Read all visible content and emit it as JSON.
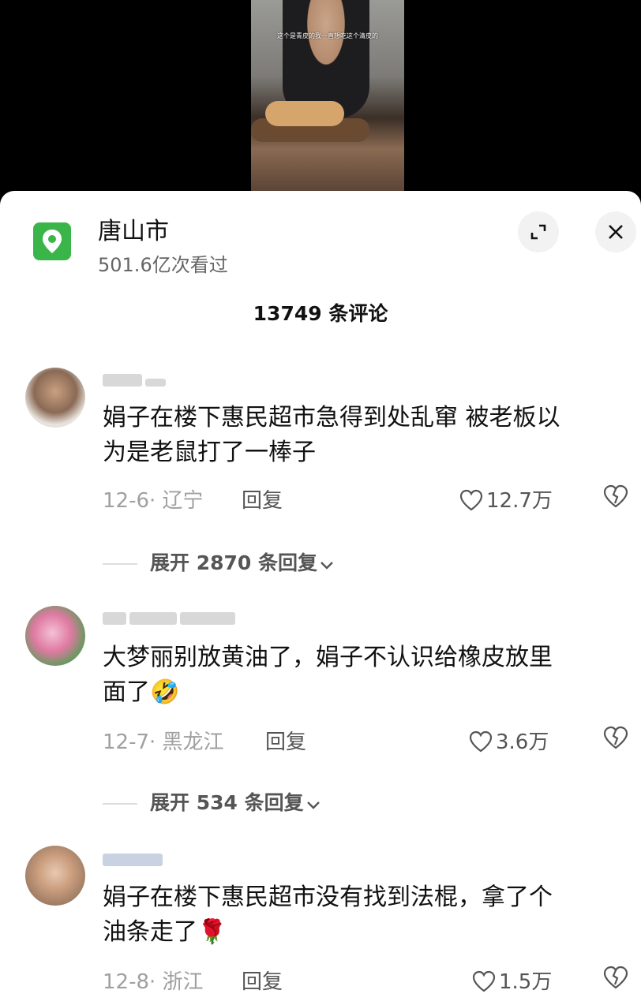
{
  "video": {
    "caption": "这个是青皮的我一直想吃这个清皮的"
  },
  "location": {
    "title": "唐山市",
    "views": "501.6亿次看过"
  },
  "comments_header": "13749 条评论",
  "comments": [
    {
      "text_line1": "娟子在楼下惠民超市急得到处乱窜 被老板以",
      "text_line2": "为是老鼠打了一棒子",
      "date_region": "12-6· 辽宁",
      "reply_label": "回复",
      "likes": "12.7万",
      "expand_label": "展开 2870 条回复"
    },
    {
      "text_line1": "大梦丽别放黄油了，娟子不认识给橡皮放里",
      "text_line2": "面了",
      "emoji": "🤣",
      "date_region": "12-7· 黑龙江",
      "reply_label": "回复",
      "likes": "3.6万",
      "expand_label": "展开 534 条回复"
    },
    {
      "text_line1": "娟子在楼下惠民超市没有找到法棍，拿了个",
      "text_line2": "油条走了",
      "emoji": "🌹",
      "date_region": "12-8· 浙江",
      "reply_label": "回复",
      "likes": "1.5万"
    }
  ],
  "colors": {
    "location_icon": "#3ab54a",
    "meta_text": "#a0a0a0"
  }
}
